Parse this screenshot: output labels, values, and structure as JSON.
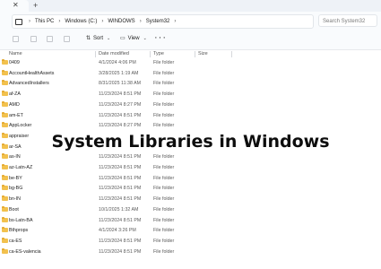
{
  "tabs": {
    "close_glyph": "✕",
    "new_tab_glyph": "+"
  },
  "address": {
    "breadcrumbs": [
      "This PC",
      "Windows (C:)",
      "WINDOWS",
      "System32"
    ],
    "separator": "›",
    "search_placeholder": "Search System32"
  },
  "toolbar": {
    "sort_label": "Sort",
    "view_label": "View",
    "more_glyph": "···"
  },
  "columns": {
    "name": "Name",
    "date": "Date modified",
    "type": "Type",
    "size": "Size"
  },
  "rows": [
    {
      "name": "0409",
      "date": "4/1/2024 4:06 PM",
      "type": "File folder"
    },
    {
      "name": "AccountHealthAssets",
      "date": "3/28/2025 1:19 AM",
      "type": "File folder"
    },
    {
      "name": "AdvancedInstallers",
      "date": "8/31/2025 11:38 AM",
      "type": "File folder"
    },
    {
      "name": "af-ZA",
      "date": "11/23/2024 8:51 PM",
      "type": "File folder"
    },
    {
      "name": "AMD",
      "date": "11/23/2024 8:27 PM",
      "type": "File folder"
    },
    {
      "name": "am-ET",
      "date": "11/23/2024 8:51 PM",
      "type": "File folder"
    },
    {
      "name": "AppLocker",
      "date": "11/23/2024 8:27 PM",
      "type": "File folder"
    },
    {
      "name": "appraiser",
      "date": "",
      "type": ""
    },
    {
      "name": "ar-SA",
      "date": "",
      "type": ""
    },
    {
      "name": "as-IN",
      "date": "11/23/2024 8:51 PM",
      "type": "File folder"
    },
    {
      "name": "az-Latn-AZ",
      "date": "11/23/2024 8:51 PM",
      "type": "File folder"
    },
    {
      "name": "be-BY",
      "date": "11/23/2024 8:51 PM",
      "type": "File folder"
    },
    {
      "name": "bg-BG",
      "date": "11/23/2024 8:51 PM",
      "type": "File folder"
    },
    {
      "name": "bn-IN",
      "date": "11/23/2024 8:51 PM",
      "type": "File folder"
    },
    {
      "name": "Boot",
      "date": "10/1/2025 1:32 AM",
      "type": "File folder"
    },
    {
      "name": "bs-Latn-BA",
      "date": "11/23/2024 8:51 PM",
      "type": "File folder"
    },
    {
      "name": "Bthprops",
      "date": "4/1/2024 3:26 PM",
      "type": "File folder"
    },
    {
      "name": "ca-ES",
      "date": "11/23/2024 8:51 PM",
      "type": "File folder"
    },
    {
      "name": "ca-ES-valencia",
      "date": "11/23/2024 8:51 PM",
      "type": "File folder"
    }
  ],
  "overlay_title": "System Libraries in Windows",
  "colors": {
    "folder": "#f2c14e",
    "chrome": "#f9fbfd",
    "tabstrip": "#eef2f7"
  }
}
